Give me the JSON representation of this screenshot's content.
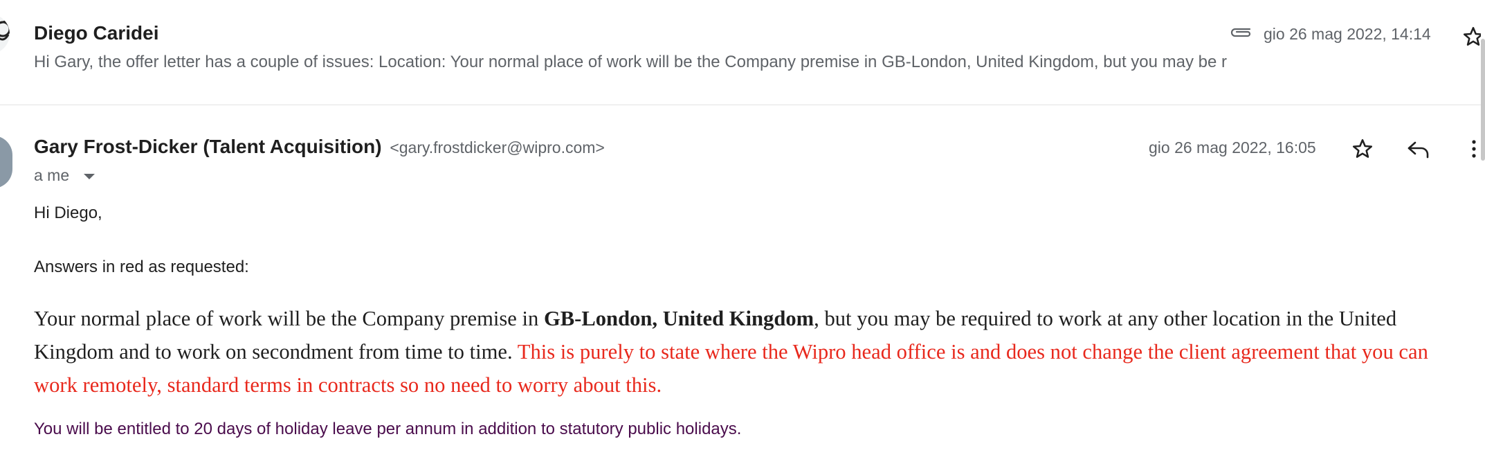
{
  "collapsed_message": {
    "sender": "Diego Caridei",
    "snippet": "Hi Gary, the offer letter has a couple of issues: Location: Your normal place of work will be the Company premise in GB-London, United Kingdom, but you may be r",
    "date": "gio 26 mag 2022, 14:14",
    "attachment_icon": "paperclip-icon",
    "star_icon": "star-icon"
  },
  "message": {
    "sender_name": "Gary Frost-Dicker (Talent Acquisition)",
    "sender_email": "<gary.frostdicker@wipro.com>",
    "recipients": "a me",
    "date": "gio 26 mag 2022, 16:05",
    "icons": {
      "star": "star-icon",
      "reply": "reply-icon",
      "more": "more-vert-icon",
      "caret": "caret-down-icon"
    },
    "body": {
      "greeting": "Hi Diego,",
      "answers_line": "Answers in red as requested:",
      "para_before": "Your normal place of work will be the Company premise in ",
      "para_bold": "GB-London, United Kingdom",
      "para_after": ", but you may be required to work at any other location in the United Kingdom and to work on secondment from time to time. ",
      "para_red": "This is purely to state where the Wipro head office is and does not change the client agreement that you can work remotely, standard terms in contracts so no need to worry about this.",
      "holiday_line": "You will be entitled to 20 days of holiday leave per annum in addition to statutory public holidays."
    }
  },
  "colors": {
    "answer_red": "#e8281c",
    "holiday_purple": "#4a0c4c",
    "meta_gray": "#5f6368"
  }
}
